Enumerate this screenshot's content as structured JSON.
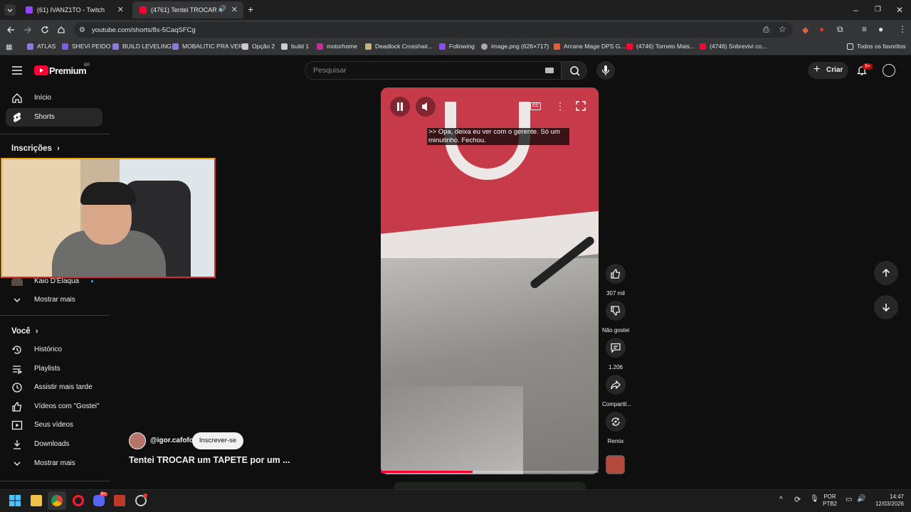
{
  "tabs": [
    {
      "label": "(61) IVANZ1TO - Twitch",
      "close": "✕"
    },
    {
      "label": "(4761) Tentei TROCAR um T",
      "close": "✕"
    }
  ],
  "new_tab": "+",
  "url": "youtube.com/shorts/8x-5CaqSFCg",
  "bookmarks": [
    "ATLAS",
    "SHEVI PEIDO",
    "BUILD LEVELING",
    "MOBALITIC PRA VER",
    "Opção 2",
    "build 1",
    "motorhome",
    "Deadlock Crosshair...",
    "Following",
    "image.png (626×717)",
    "Arcane Mage DPS G...",
    "(4746) Torneio Mais...",
    "(4746) Sobrevivi co..."
  ],
  "all_bookmarks": "Todos os favoritos",
  "youtube": {
    "logo_text": "Premium",
    "region": "BR",
    "search_placeholder": "Pesquisar",
    "create_label": "Criar",
    "notif_count": "9+"
  },
  "sidebar": {
    "top": [
      {
        "label": "Início",
        "icon": "home-icon"
      },
      {
        "label": "Shorts",
        "icon": "shorts-icon"
      }
    ],
    "subs_title": "Inscrições",
    "subs_partial": "Kaio D'Elaqua",
    "show_more": "Mostrar mais",
    "you_title": "Você",
    "you_items": [
      {
        "label": "Histórico",
        "icon": "history-icon"
      },
      {
        "label": "Playlists",
        "icon": "playlists-icon"
      },
      {
        "label": "Assistir mais tarde",
        "icon": "watch-later-icon"
      },
      {
        "label": "Vídeos com \"Gostei\"",
        "icon": "like-icon"
      },
      {
        "label": "Seus vídeos",
        "icon": "your-videos-icon"
      },
      {
        "label": "Downloads",
        "icon": "download-icon"
      },
      {
        "label": "Mostrar mais",
        "icon": "chevron-down-icon"
      }
    ]
  },
  "short": {
    "subtitle": ">> Opa, deixa eu ver com o gerente. Só um minutinho. Fechou.",
    "channel": "@igor.cafofo",
    "subscribe": "Inscrever-se",
    "title": "Tentei TROCAR um TAPETE por um ...",
    "progress": 0.42
  },
  "actions": [
    {
      "label": "307 mil",
      "icon": "like-icon"
    },
    {
      "label": "Não gostei",
      "icon": "dislike-icon"
    },
    {
      "label": "1.206",
      "icon": "comment-icon"
    },
    {
      "label": "Compartil...",
      "icon": "share-icon"
    },
    {
      "label": "Remix",
      "icon": "remix-icon"
    }
  ],
  "taskbar": {
    "lang_top": "POR",
    "lang_bottom": "PTB2",
    "time": "14:47",
    "date": "12/03/2026",
    "discord_badge": "9+"
  },
  "colors": {
    "yt_red": "#ff0033",
    "accent": "#3ea6ff"
  }
}
